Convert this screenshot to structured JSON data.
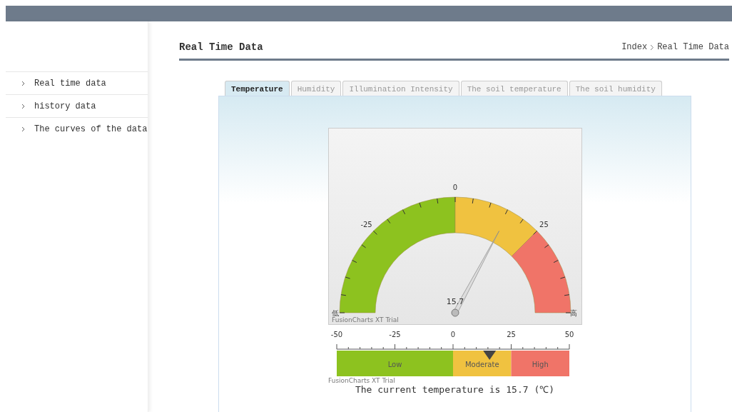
{
  "page_title": "Real Time Data",
  "breadcrumb": [
    {
      "label": "Index"
    },
    {
      "label": "Real Time Data"
    }
  ],
  "sidebar": {
    "items": [
      {
        "label": "Real time data",
        "selected": false
      },
      {
        "label": "history data",
        "selected": false
      },
      {
        "label": "The curves of the data",
        "selected": false
      }
    ]
  },
  "tabs": [
    {
      "label": "Temperature",
      "selected": true
    },
    {
      "label": "Humidity",
      "selected": false
    },
    {
      "label": "Illumination Intensity",
      "selected": false
    },
    {
      "label": "The soil temperature",
      "selected": false
    },
    {
      "label": "The soil humidity",
      "selected": false
    }
  ],
  "gauge": {
    "level": 0.657,
    "value_label": "15.7",
    "min_label": "低",
    "max_label": "高",
    "trial_text": "FusionCharts XT Trial",
    "ticks": [
      {
        "label": "-25"
      },
      {
        "label": "0"
      },
      {
        "label": "25"
      }
    ],
    "bands": [
      {
        "color": "#8dc21f"
      },
      {
        "color": "#f0c240"
      },
      {
        "color": "#f07468"
      }
    ]
  },
  "linear_gauge": {
    "level": 0.657,
    "trial_text": "FusionCharts XT Trial",
    "ticks": [
      {
        "label": "-50"
      },
      {
        "label": "-25"
      },
      {
        "label": "0"
      },
      {
        "label": "25"
      },
      {
        "label": "50"
      }
    ],
    "bands": [
      {
        "label": "Low",
        "color": "#8dc21f"
      },
      {
        "label": "Moderate",
        "color": "#f0c240"
      },
      {
        "label": "High",
        "color": "#f07468"
      }
    ]
  },
  "reading": "The current temperature is 15.7 (℃)"
}
